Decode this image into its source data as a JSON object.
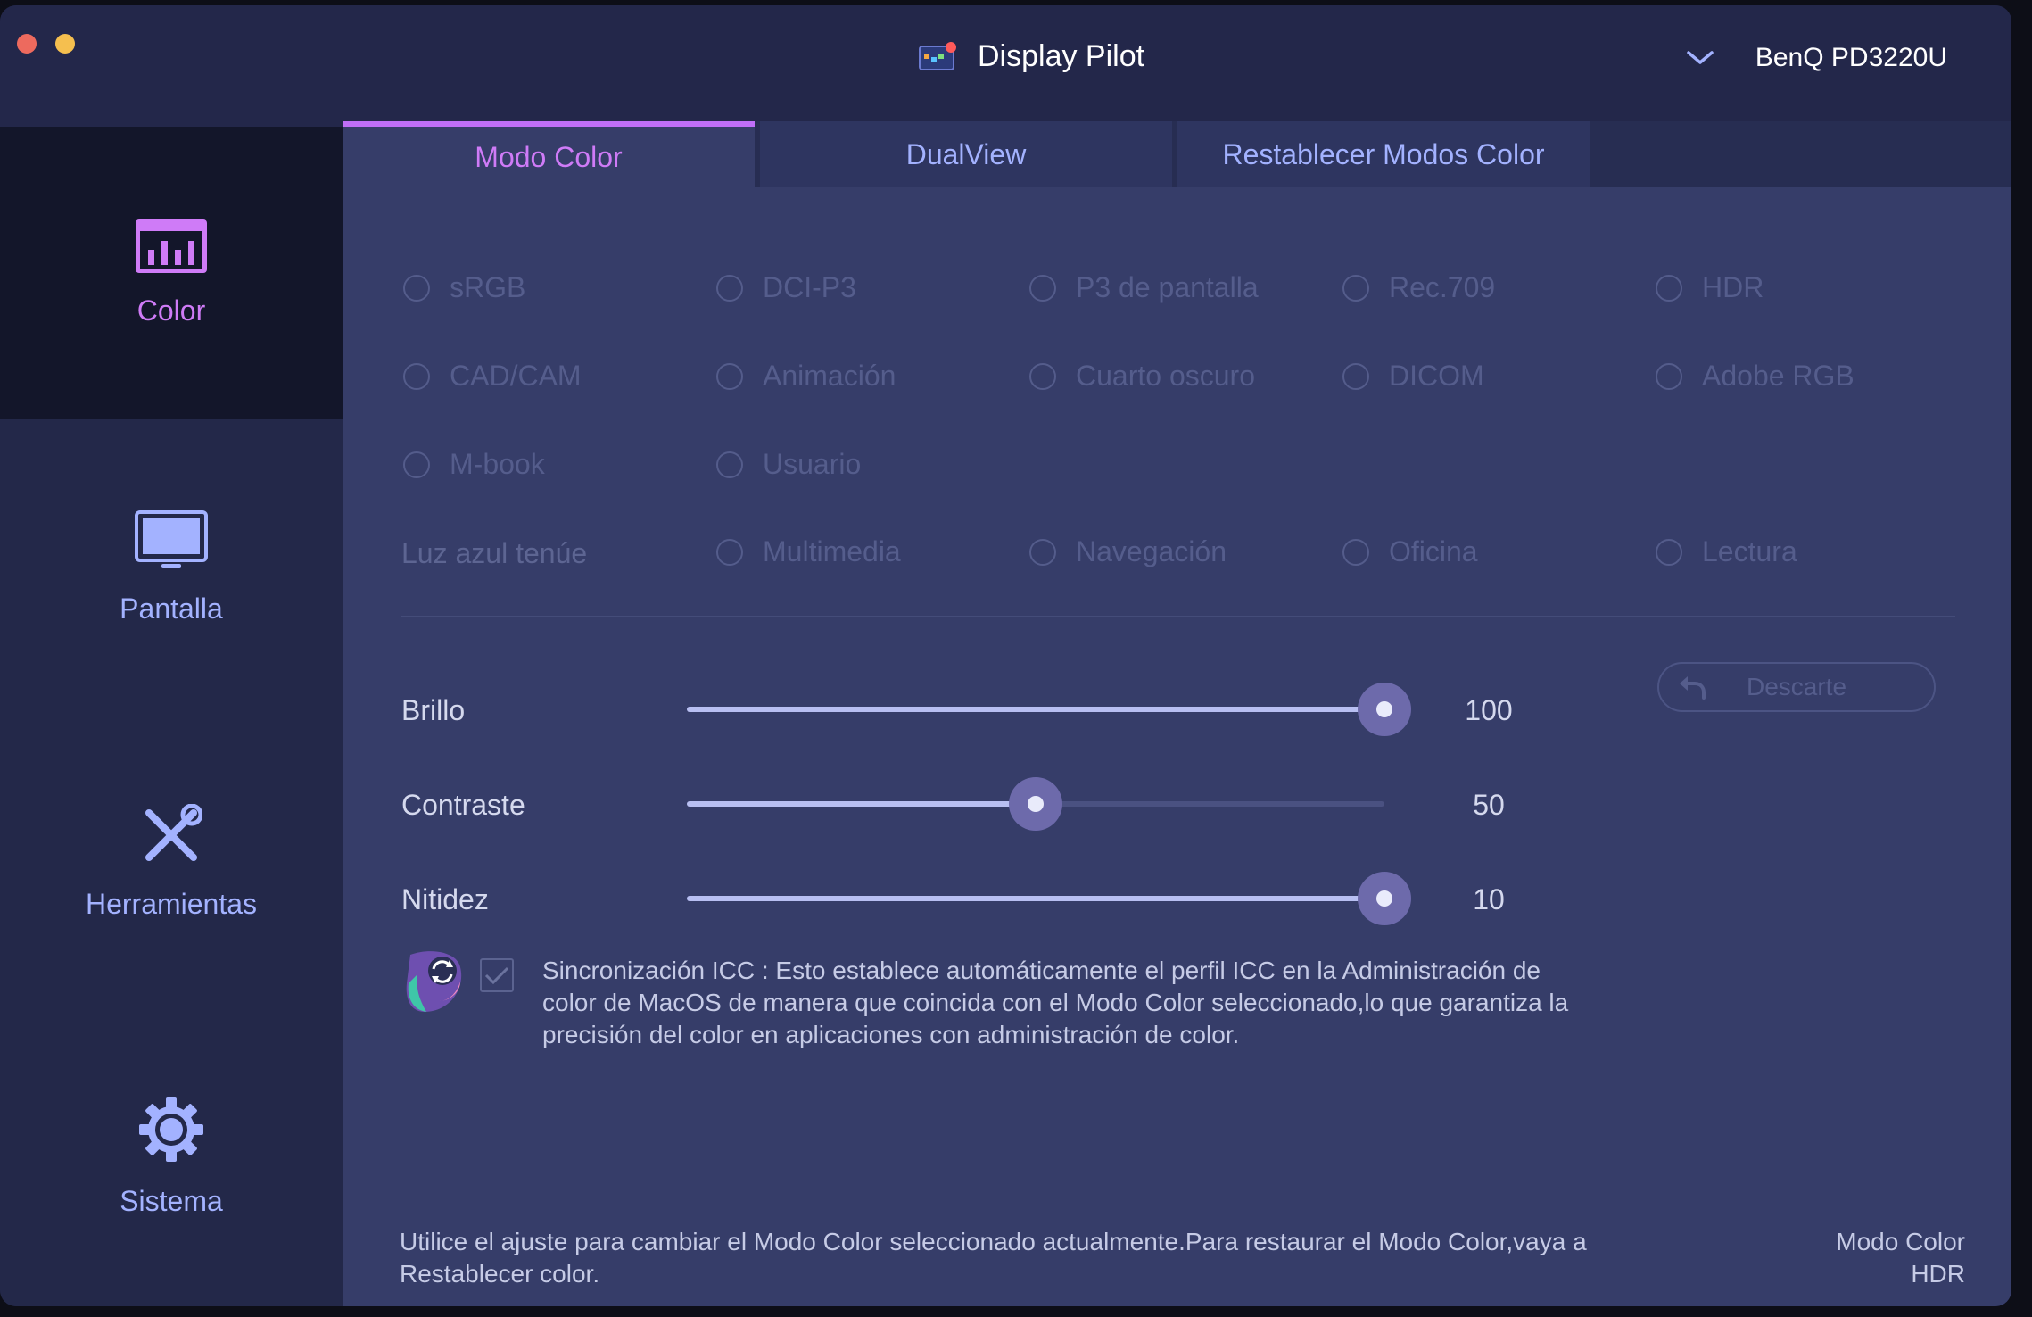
{
  "window": {
    "title": "Display Pilot",
    "monitor": "BenQ PD3220U"
  },
  "sidebar": {
    "items": [
      {
        "label": "Color",
        "icon": "color-chart-icon",
        "active": true
      },
      {
        "label": "Pantalla",
        "icon": "monitor-icon",
        "active": false
      },
      {
        "label": "Herramientas",
        "icon": "tools-icon",
        "active": false
      },
      {
        "label": "Sistema",
        "icon": "gear-icon",
        "active": false
      }
    ]
  },
  "tabs": [
    {
      "label": "Modo Color",
      "active": true
    },
    {
      "label": "DualView",
      "active": false
    },
    {
      "label": "Restablecer Modos Color",
      "active": false
    }
  ],
  "color_modes": {
    "row1": [
      "sRGB",
      "DCI-P3",
      "P3 de pantalla",
      "Rec.709",
      "HDR"
    ],
    "row2": [
      "CAD/CAM",
      "Animación",
      "Cuarto oscuro",
      "DICOM",
      "Adobe RGB"
    ],
    "row3": [
      "M-book",
      "Usuario"
    ],
    "low_blue_light_label": "Luz azul tenúe",
    "low_blue_light": [
      "Multimedia",
      "Navegación",
      "Oficina",
      "Lectura"
    ]
  },
  "sliders": {
    "brightness": {
      "label": "Brillo",
      "value": 100,
      "max": 100
    },
    "contrast": {
      "label": "Contraste",
      "value": 50,
      "max": 100
    },
    "sharpness": {
      "label": "Nitidez",
      "value": 10,
      "max": 10
    }
  },
  "discard_label": "Descarte",
  "icc": {
    "checked": true,
    "text": "Sincronización ICC : Esto establece automáticamente el perfil ICC en la Administración de color de MacOS de manera que coincida con el Modo Color seleccionado,lo que garantiza la precisión del color en aplicaciones con administración de color."
  },
  "footer": {
    "text": "Utilice el ajuste para cambiar el Modo Color seleccionado actualmente.Para restaurar el Modo Color,vaya a Restablecer color.",
    "mode_label": "Modo Color",
    "mode_value": "HDR"
  },
  "colors": {
    "accent": "#cf7bf7",
    "inactive_text": "#a3b2ff",
    "panel": "#363d69"
  }
}
